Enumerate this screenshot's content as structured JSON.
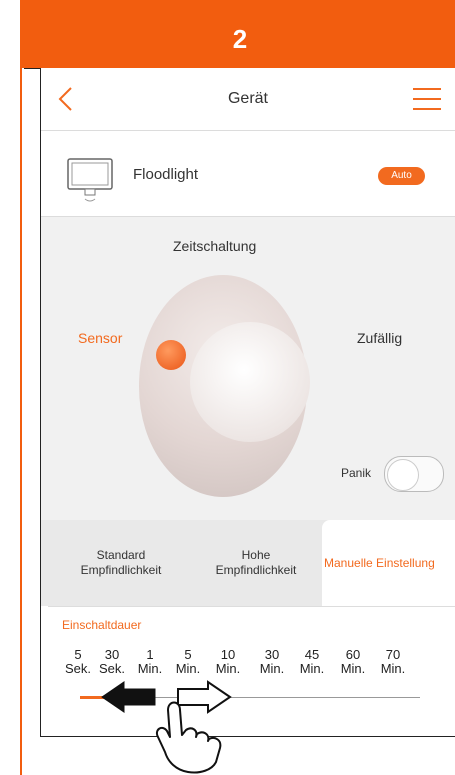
{
  "step_banner": {
    "number": "2",
    "color": "#f25d0f"
  },
  "header": {
    "title": "Gerät",
    "back_icon": "chevron-left-icon",
    "menu_icon": "hamburger-menu-icon"
  },
  "device": {
    "name": "Floodlight",
    "icon": "floodlight-icon",
    "badge": "Auto"
  },
  "modes": {
    "top": "Zeitschaltung",
    "left": "Sensor",
    "right": "Zufällig",
    "panic": "Panik",
    "active": "Sensor",
    "panic_toggle_on": false
  },
  "tabs": [
    {
      "line1": "Standard",
      "line2": "Empfindlichkeit"
    },
    {
      "line1": "Hohe",
      "line2": "Empfindlichkeit"
    },
    {
      "line1": "Manuelle Einstellung",
      "line2": ""
    }
  ],
  "active_tab": "Manuelle Einstellung",
  "duration": {
    "title": "Einschaltdauer",
    "ticks": [
      {
        "value": "5",
        "unit": "Sek."
      },
      {
        "value": "30",
        "unit": "Sek."
      },
      {
        "value": "1",
        "unit": "Min."
      },
      {
        "value": "5",
        "unit": "Min."
      },
      {
        "value": "10",
        "unit": "Min."
      },
      {
        "value": "30",
        "unit": "Min."
      },
      {
        "value": "45",
        "unit": "Min."
      },
      {
        "value": "60",
        "unit": "Min."
      },
      {
        "value": "70",
        "unit": "Min."
      }
    ],
    "selected": "5 Sek."
  },
  "accent_color": "#f26a1f",
  "gesture": {
    "icons": [
      "arrow-left-icon",
      "arrow-right-icon",
      "hand-pointer-icon"
    ]
  }
}
